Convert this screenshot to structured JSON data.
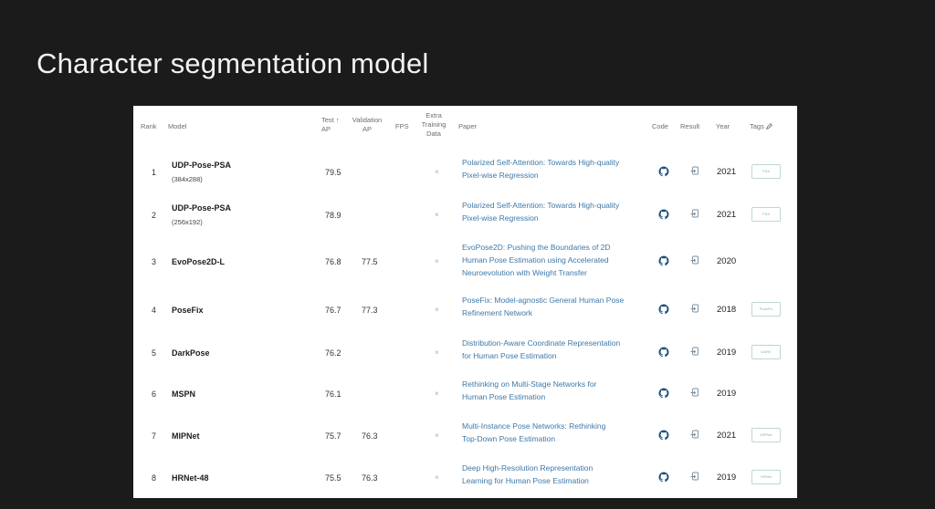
{
  "slide": {
    "title": "Character segmentation model"
  },
  "table": {
    "headers": {
      "rank": "Rank",
      "model": "Model",
      "test_ap_line1": "Test",
      "test_ap_line2": "AP",
      "validation_ap_line1": "Validation",
      "validation_ap_line2": "AP",
      "fps": "FPS",
      "extra_line1": "Extra",
      "extra_line2": "Training",
      "extra_line3": "Data",
      "paper": "Paper",
      "code": "Code",
      "result": "Result",
      "year": "Year",
      "tags": "Tags"
    },
    "rows": [
      {
        "rank": "1",
        "model": "UDP-Pose-PSA",
        "subtitle": "(384x288)",
        "test_ap": "79.5",
        "validation_ap": "",
        "extra": "×",
        "paper_line1": "Polarized Self-Attention: Towards High-quality",
        "paper_line2": "Pixel-wise Regression",
        "paper_line3": "",
        "year": "2021",
        "tag": "PSA"
      },
      {
        "rank": "2",
        "model": "UDP-Pose-PSA",
        "subtitle": "(256x192)",
        "test_ap": "78.9",
        "validation_ap": "",
        "extra": "×",
        "paper_line1": "Polarized Self-Attention: Towards High-quality",
        "paper_line2": "Pixel-wise Regression",
        "paper_line3": "",
        "year": "2021",
        "tag": "PSA"
      },
      {
        "rank": "3",
        "model": "EvoPose2D-L",
        "subtitle": "",
        "test_ap": "76.8",
        "validation_ap": "77.5",
        "extra": "×",
        "paper_line1": "EvoPose2D: Pushing the Boundaries of 2D",
        "paper_line2": "Human Pose Estimation using Accelerated",
        "paper_line3": "Neuroevolution with Weight Transfer",
        "year": "2020",
        "tag": ""
      },
      {
        "rank": "4",
        "model": "PoseFix",
        "subtitle": "",
        "test_ap": "76.7",
        "validation_ap": "77.3",
        "extra": "×",
        "paper_line1": "PoseFix: Model-agnostic General Human Pose",
        "paper_line2": "Refinement Network",
        "paper_line3": "",
        "year": "2018",
        "tag": "PoseFix"
      },
      {
        "rank": "5",
        "model": "DarkPose",
        "subtitle": "",
        "test_ap": "76.2",
        "validation_ap": "",
        "extra": "×",
        "paper_line1": "Distribution-Aware Coordinate Representation",
        "paper_line2": "for Human Pose Estimation",
        "paper_line3": "",
        "year": "2019",
        "tag": "DARK"
      },
      {
        "rank": "6",
        "model": "MSPN",
        "subtitle": "",
        "test_ap": "76.1",
        "validation_ap": "",
        "extra": "×",
        "paper_line1": "Rethinking on Multi-Stage Networks for",
        "paper_line2": "Human Pose Estimation",
        "paper_line3": "",
        "year": "2019",
        "tag": ""
      },
      {
        "rank": "7",
        "model": "MIPNet",
        "subtitle": "",
        "test_ap": "75.7",
        "validation_ap": "76.3",
        "extra": "×",
        "paper_line1": "Multi-Instance Pose Networks: Rethinking",
        "paper_line2": "Top-Down Pose Estimation",
        "paper_line3": "",
        "year": "2021",
        "tag": "MIPNet"
      },
      {
        "rank": "8",
        "model": "HRNet-48",
        "subtitle": "",
        "test_ap": "75.5",
        "validation_ap": "76.3",
        "extra": "×",
        "paper_line1": "Deep High-Resolution Representation",
        "paper_line2": "Learning for Human Pose Estimation",
        "paper_line3": "",
        "year": "2019",
        "tag": "HRNet"
      }
    ]
  },
  "icons": {
    "code": "github-icon",
    "result": "result-icon",
    "tags_edit": "edit-icon"
  },
  "colors": {
    "link": "#3d78a8",
    "tag_border": "#bcd8d0",
    "background": "#1b1b1b"
  }
}
